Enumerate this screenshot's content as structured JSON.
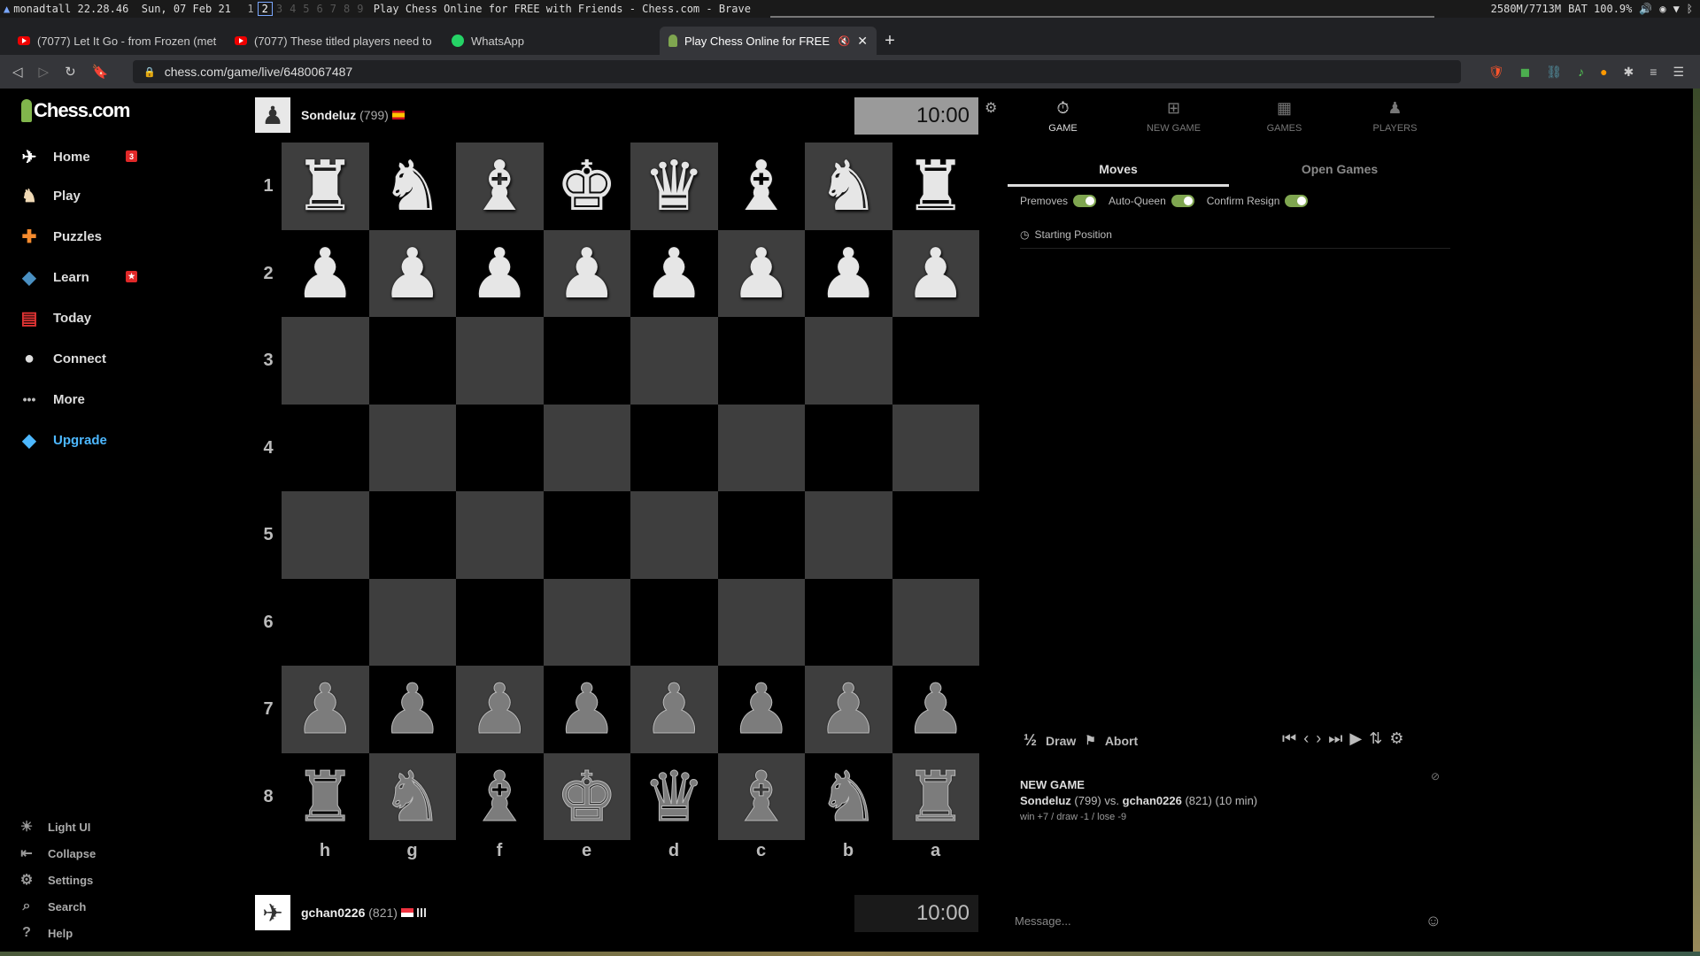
{
  "system_bar": {
    "user": "monadtall",
    "time": "22.28.46",
    "date": "Sun, 07 Feb 21",
    "workspaces": [
      "1",
      "2",
      "3",
      "4",
      "5",
      "6",
      "7",
      "8",
      "9"
    ],
    "active_workspace": "2",
    "window_title": "Play Chess Online for FREE with Friends - Chess.com - Brave",
    "memory": "2580M/7713M",
    "battery": "BAT 100.9%"
  },
  "browser": {
    "tabs": [
      {
        "title": "(7077) Let It Go - from Frozen (met",
        "icon": "youtube-icon"
      },
      {
        "title": "(7077) These titled players need to",
        "icon": "youtube-icon"
      },
      {
        "title": "WhatsApp",
        "icon": "whatsapp-icon"
      },
      {
        "title": "Play Chess Online for FREE",
        "icon": "chess-pawn-icon",
        "active": true
      }
    ],
    "new_tab": "+",
    "url": "chess.com/game/live/6480067487"
  },
  "sidebar": {
    "logo": "Chess.com",
    "items": [
      {
        "label": "Home",
        "icon": "home-icon",
        "badge": "3"
      },
      {
        "label": "Play",
        "icon": "play-icon"
      },
      {
        "label": "Puzzles",
        "icon": "puzzle-icon"
      },
      {
        "label": "Learn",
        "icon": "learn-icon",
        "badge": "★"
      },
      {
        "label": "Today",
        "icon": "today-icon"
      },
      {
        "label": "Connect",
        "icon": "connect-icon"
      },
      {
        "label": "More",
        "icon": "more-icon"
      },
      {
        "label": "Upgrade",
        "icon": "diamond-icon"
      }
    ],
    "bottom": [
      {
        "label": "Light UI",
        "icon": "sun-icon"
      },
      {
        "label": "Collapse",
        "icon": "collapse-icon"
      },
      {
        "label": "Settings",
        "icon": "gear-icon"
      },
      {
        "label": "Search",
        "icon": "search-icon"
      },
      {
        "label": "Help",
        "icon": "help-icon"
      }
    ]
  },
  "game": {
    "top_player": {
      "name": "Sondeluz",
      "rating": "(799)",
      "clock": "10:00"
    },
    "bottom_player": {
      "name": "gchan0226",
      "rating": "(821)",
      "clock": "10:00"
    },
    "ranks": [
      "1",
      "2",
      "3",
      "4",
      "5",
      "6",
      "7",
      "8"
    ],
    "files": [
      "h",
      "g",
      "f",
      "e",
      "d",
      "c",
      "b",
      "a"
    ],
    "board": [
      [
        "wR",
        "wN",
        "wB",
        "wK",
        "wQ",
        "wB",
        "wN",
        "wR"
      ],
      [
        "wP",
        "wP",
        "wP",
        "wP",
        "wP",
        "wP",
        "wP",
        "wP"
      ],
      [
        "",
        "",
        "",
        "",
        "",
        "",
        "",
        ""
      ],
      [
        "",
        "",
        "",
        "",
        "",
        "",
        "",
        ""
      ],
      [
        "",
        "",
        "",
        "",
        "",
        "",
        "",
        ""
      ],
      [
        "",
        "",
        "",
        "",
        "",
        "",
        "",
        ""
      ],
      [
        "bP",
        "bP",
        "bP",
        "bP",
        "bP",
        "bP",
        "bP",
        "bP"
      ],
      [
        "bR",
        "bN",
        "bB",
        "bK",
        "bQ",
        "bB",
        "bN",
        "bR"
      ]
    ]
  },
  "panel": {
    "tabs": [
      {
        "label": "GAME",
        "icon": "stopwatch-icon"
      },
      {
        "label": "NEW GAME",
        "icon": "plus-square-icon"
      },
      {
        "label": "GAMES",
        "icon": "checkerboard-icon"
      },
      {
        "label": "PLAYERS",
        "icon": "players-icon"
      }
    ],
    "subtabs": [
      "Moves",
      "Open Games"
    ],
    "toggles": [
      "Premoves",
      "Auto-Queen",
      "Confirm Resign"
    ],
    "starting_position": "Starting Position",
    "draw_label": "Draw",
    "draw_icon": "½",
    "abort_label": "Abort",
    "info": {
      "header": "NEW GAME",
      "player1": "Sondeluz",
      "rating1": "(799)",
      "vs": "vs.",
      "player2": "gchan0226",
      "rating2": "(821)",
      "time_control": "(10 min)",
      "stakes": "win +7 / draw -1 / lose -9"
    },
    "message_placeholder": "Message..."
  }
}
